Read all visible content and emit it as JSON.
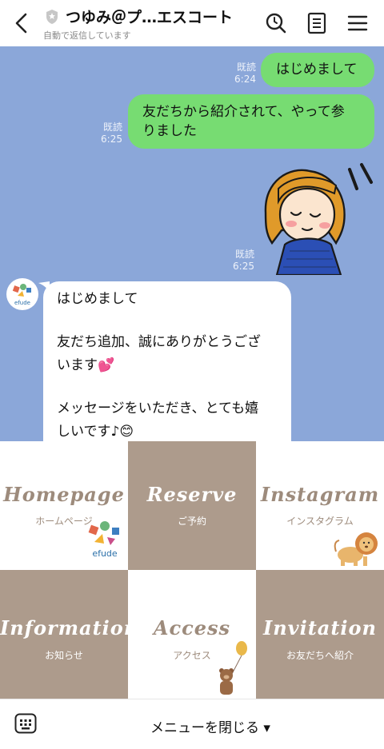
{
  "header": {
    "title": "つゆみ＠プ…エスコート",
    "subtitle": "自動で返信しています",
    "icons": [
      "back-chevron-icon",
      "shield-icon",
      "search-icon",
      "notes-icon",
      "menu-icon"
    ]
  },
  "chat": {
    "messages": [
      {
        "side": "right",
        "type": "text",
        "text": "はじめまして",
        "read": "既読",
        "time": "6:24"
      },
      {
        "side": "right",
        "type": "text",
        "lines": [
          "友だちから紹介されて、やって参",
          "りました"
        ],
        "read": "既読",
        "time": "6:25"
      },
      {
        "side": "right",
        "type": "sticker",
        "sticker": "girl-bowing-sticker",
        "read": "既読",
        "time": "6:25"
      },
      {
        "side": "left",
        "type": "text",
        "lines": [
          "はじめまして",
          "",
          "友だち追加、誠にありがとうござ",
          "います💕",
          "",
          "メッセージをいただき、とても嬉",
          "しいです♪😊"
        ]
      }
    ],
    "avatar_text": "efude"
  },
  "rich_menu": {
    "tiles": [
      {
        "script": "Homepage",
        "sub": "ホームページ",
        "logo": "efude"
      },
      {
        "script": "Reserve",
        "sub": "ご予約"
      },
      {
        "script": "Instagram",
        "sub": "インスタグラム"
      },
      {
        "script": "Information",
        "sub": "お知らせ"
      },
      {
        "script": "Access",
        "sub": "アクセス"
      },
      {
        "script": "Invitation",
        "sub": "お友だちへ紹介"
      }
    ]
  },
  "bottom": {
    "close_label": "メニューを閉じる ▾"
  },
  "colors": {
    "chat_bg": "#8ba7d9",
    "green_bubble": "#77dc72",
    "menu_brown": "#ad9b8c",
    "menu_text_brown": "#9d8b7c"
  }
}
